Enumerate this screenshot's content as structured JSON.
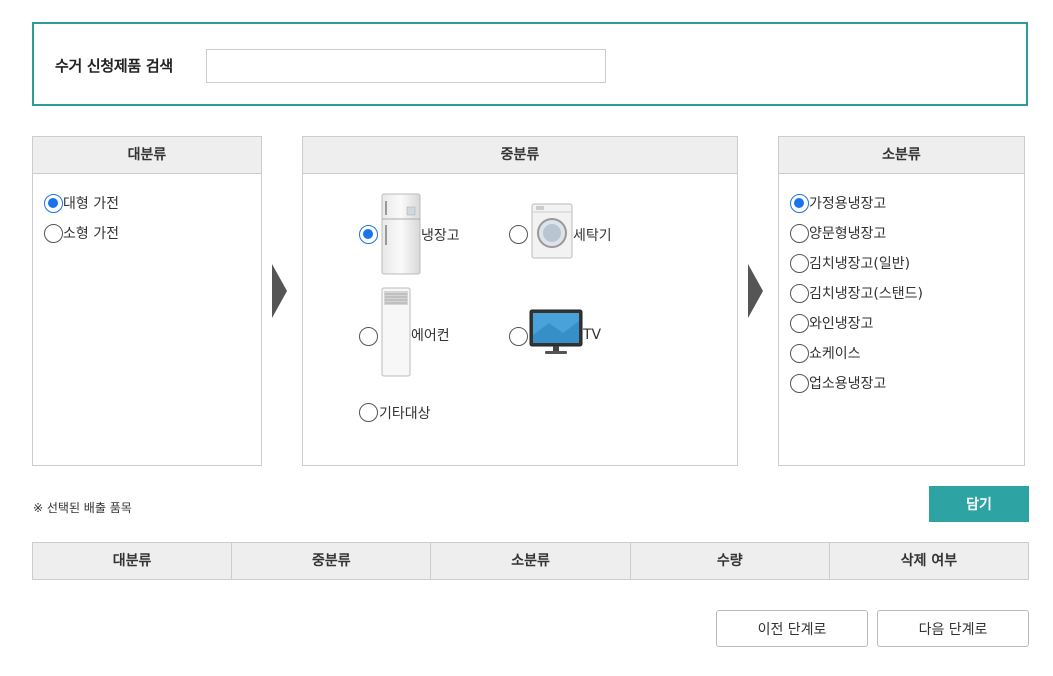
{
  "search": {
    "label": "수거 신청제품 검색",
    "value": "",
    "placeholder": ""
  },
  "large": {
    "title": "대분류",
    "items": [
      {
        "label": "대형 가전",
        "checked": true
      },
      {
        "label": "소형 가전",
        "checked": false
      }
    ]
  },
  "mid": {
    "title": "중분류",
    "items": [
      {
        "label": "냉장고",
        "checked": true,
        "icon": "refrigerator-icon"
      },
      {
        "label": "세탁기",
        "checked": false,
        "icon": "washing-machine-icon"
      },
      {
        "label": "에어컨",
        "checked": false,
        "icon": "air-conditioner-icon"
      },
      {
        "label": "TV",
        "checked": false,
        "icon": "tv-icon"
      },
      {
        "label": "기타대상",
        "checked": false
      }
    ]
  },
  "small": {
    "title": "소분류",
    "items": [
      {
        "label": "가정용냉장고",
        "checked": true
      },
      {
        "label": "양문형냉장고",
        "checked": false
      },
      {
        "label": "김치냉장고(일반)",
        "checked": false
      },
      {
        "label": "김치냉장고(스탠드)",
        "checked": false
      },
      {
        "label": "와인냉장고",
        "checked": false
      },
      {
        "label": "쇼케이스",
        "checked": false
      },
      {
        "label": "업소용냉장고",
        "checked": false
      }
    ]
  },
  "selected_note": "※ 선택된 배출 품목",
  "add_button": "담기",
  "table": {
    "headers": [
      "대분류",
      "중분류",
      "소분류",
      "수량",
      "삭제 여부"
    ]
  },
  "nav": {
    "prev": "이전 단계로",
    "next": "다음 단계로"
  },
  "colors": {
    "accent": "#2ea3a3",
    "border_accent": "#2c9c9c",
    "radio_selected": "#1a73e8"
  }
}
